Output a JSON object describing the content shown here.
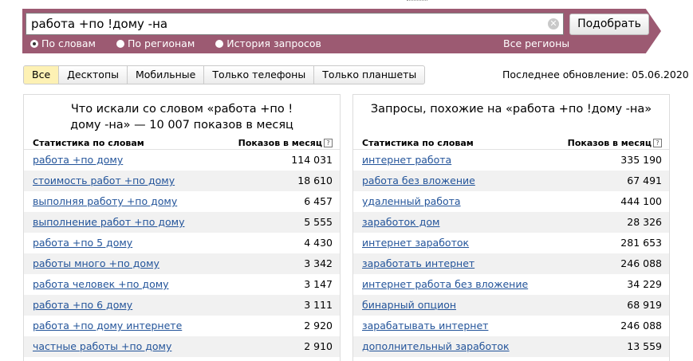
{
  "search": {
    "query": "работа +по !дому -на",
    "submit_label": "Подобрать",
    "radios": [
      {
        "label": "По словам",
        "checked": true
      },
      {
        "label": "По регионам",
        "checked": false
      },
      {
        "label": "История запросов",
        "checked": false
      }
    ],
    "regions_label": "Все регионы"
  },
  "tabs": [
    "Все",
    "Десктопы",
    "Мобильные",
    "Только телефоны",
    "Только планшеты"
  ],
  "updated": "Последнее обновление: 05.06.2020",
  "left": {
    "title": "Что искали со словом «работа +по !дому -на» — 10 007 показов в месяц",
    "col_words": "Статистика по словам",
    "col_count": "Показов в месяц",
    "rows": [
      {
        "q": "работа +по дому",
        "n": "114 031"
      },
      {
        "q": "стоимость работ +по дому",
        "n": "18 610"
      },
      {
        "q": "выполняя работу +по дому",
        "n": "6 457"
      },
      {
        "q": "выполнение работ +по дому",
        "n": "5 555"
      },
      {
        "q": "работа +по 5 дому",
        "n": "4 430"
      },
      {
        "q": "работы много +по дому",
        "n": "3 342"
      },
      {
        "q": "работа человек +по дому",
        "n": "3 147"
      },
      {
        "q": "работа +по 6 дому",
        "n": "3 111"
      },
      {
        "q": "работа +по дому интернете",
        "n": "2 920"
      },
      {
        "q": "частные работы +по дому",
        "n": "2 910"
      }
    ]
  },
  "right": {
    "title": "Запросы, похожие на «работа +по !дому -на»",
    "col_words": "Статистика по словам",
    "col_count": "Показов в месяц",
    "rows": [
      {
        "q": "интернет работа",
        "n": "335 190"
      },
      {
        "q": "работа без вложение",
        "n": "67 491"
      },
      {
        "q": "удаленный работа",
        "n": "444 100"
      },
      {
        "q": "заработок дом",
        "n": "28 326"
      },
      {
        "q": "интернет заработок",
        "n": "281 653"
      },
      {
        "q": "заработать интернет",
        "n": "246 088"
      },
      {
        "q": "интернет работа без вложение",
        "n": "34 229"
      },
      {
        "q": "бинарный опцион",
        "n": "68 919"
      },
      {
        "q": "зарабатывать интернет",
        "n": "246 088"
      },
      {
        "q": "дополнительный заработок",
        "n": "13 559"
      }
    ]
  }
}
